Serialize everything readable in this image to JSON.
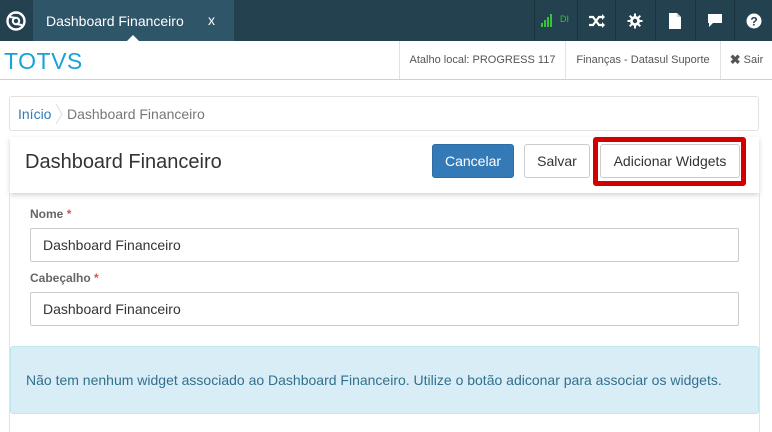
{
  "topbar": {
    "tab_label": "Dashboard Financeiro",
    "tab_close": "x",
    "signal_label": "DI",
    "colors": {
      "bar": "#24414f",
      "tab": "#2f5568",
      "signal": "#3cc13c"
    }
  },
  "header": {
    "brand": "TOTVS",
    "shortcut": "Atalho local: PROGRESS 117",
    "company": "Finanças - Datasul Suporte",
    "logout": "Sair"
  },
  "breadcrumb": {
    "home": "Início",
    "current": "Dashboard Financeiro"
  },
  "page": {
    "title": "Dashboard Financeiro",
    "cancel_label": "Cancelar",
    "save_label": "Salvar",
    "add_widgets_label": "Adicionar Widgets"
  },
  "form": {
    "name_label": "Nome",
    "name_value": "Dashboard Financeiro",
    "header_label": "Cabeçalho",
    "header_value": "Dashboard Financeiro",
    "required_mark": "*"
  },
  "alert": {
    "message": "Não tem nenhum widget associado ao Dashboard Financeiro. Utilize o botão adiconar para associar os widgets."
  },
  "icons": [
    "totvs-logo-icon",
    "signal-icon",
    "shuffle-icon",
    "gear-icon",
    "document-icon",
    "chat-icon",
    "help-icon",
    "close-icon"
  ]
}
